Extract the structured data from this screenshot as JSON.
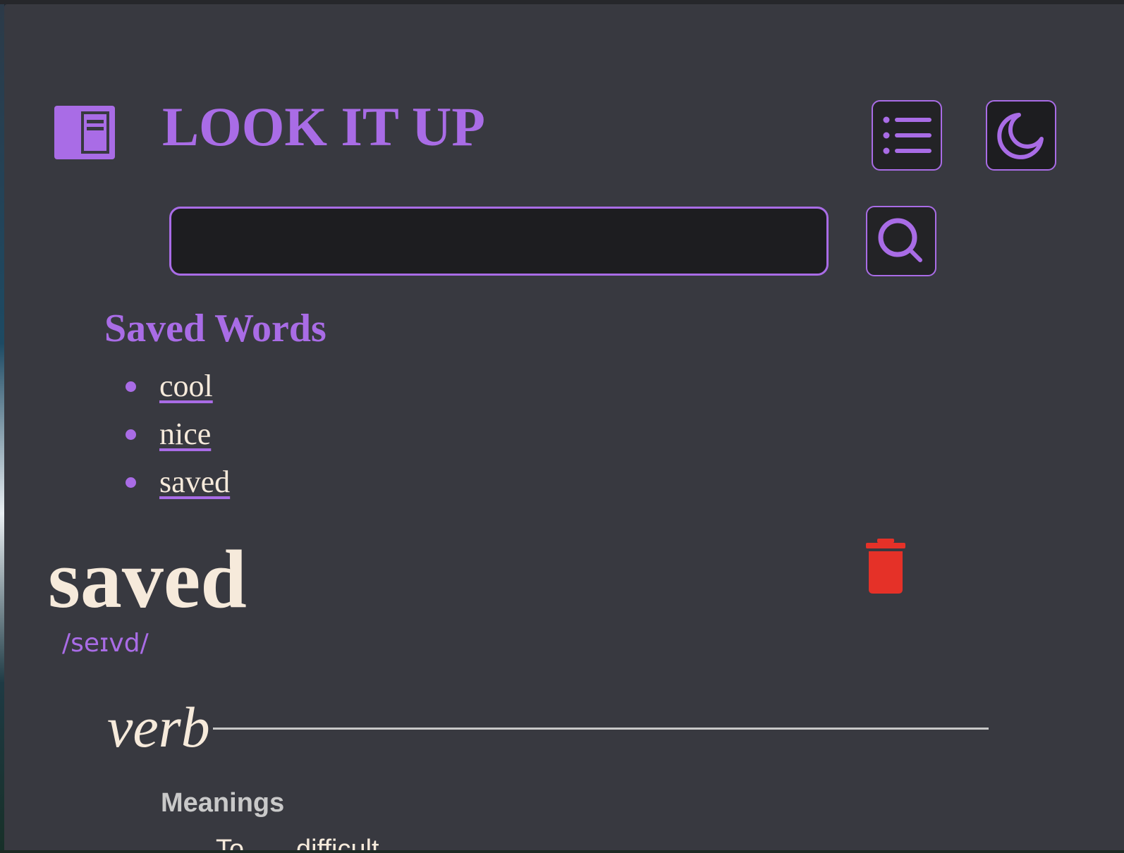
{
  "app": {
    "title": "LOOK IT UP"
  },
  "search": {
    "value": "",
    "placeholder": ""
  },
  "saved": {
    "heading": "Saved Words",
    "words": [
      "cool",
      "nice",
      "saved"
    ]
  },
  "entry": {
    "word": "saved",
    "phonetic": "/seɪvd/",
    "part_of_speech": "verb",
    "meanings_label": "Meanings",
    "first_meaning": "To...  ...difficult"
  },
  "icons": {
    "logo": "book-icon",
    "menu": "list-icon",
    "theme": "moon-icon",
    "search": "search-icon",
    "delete": "trash-icon"
  },
  "colors": {
    "accent": "#a96ce6",
    "background": "#383940",
    "text": "#f6eadb",
    "delete": "#e53128"
  }
}
